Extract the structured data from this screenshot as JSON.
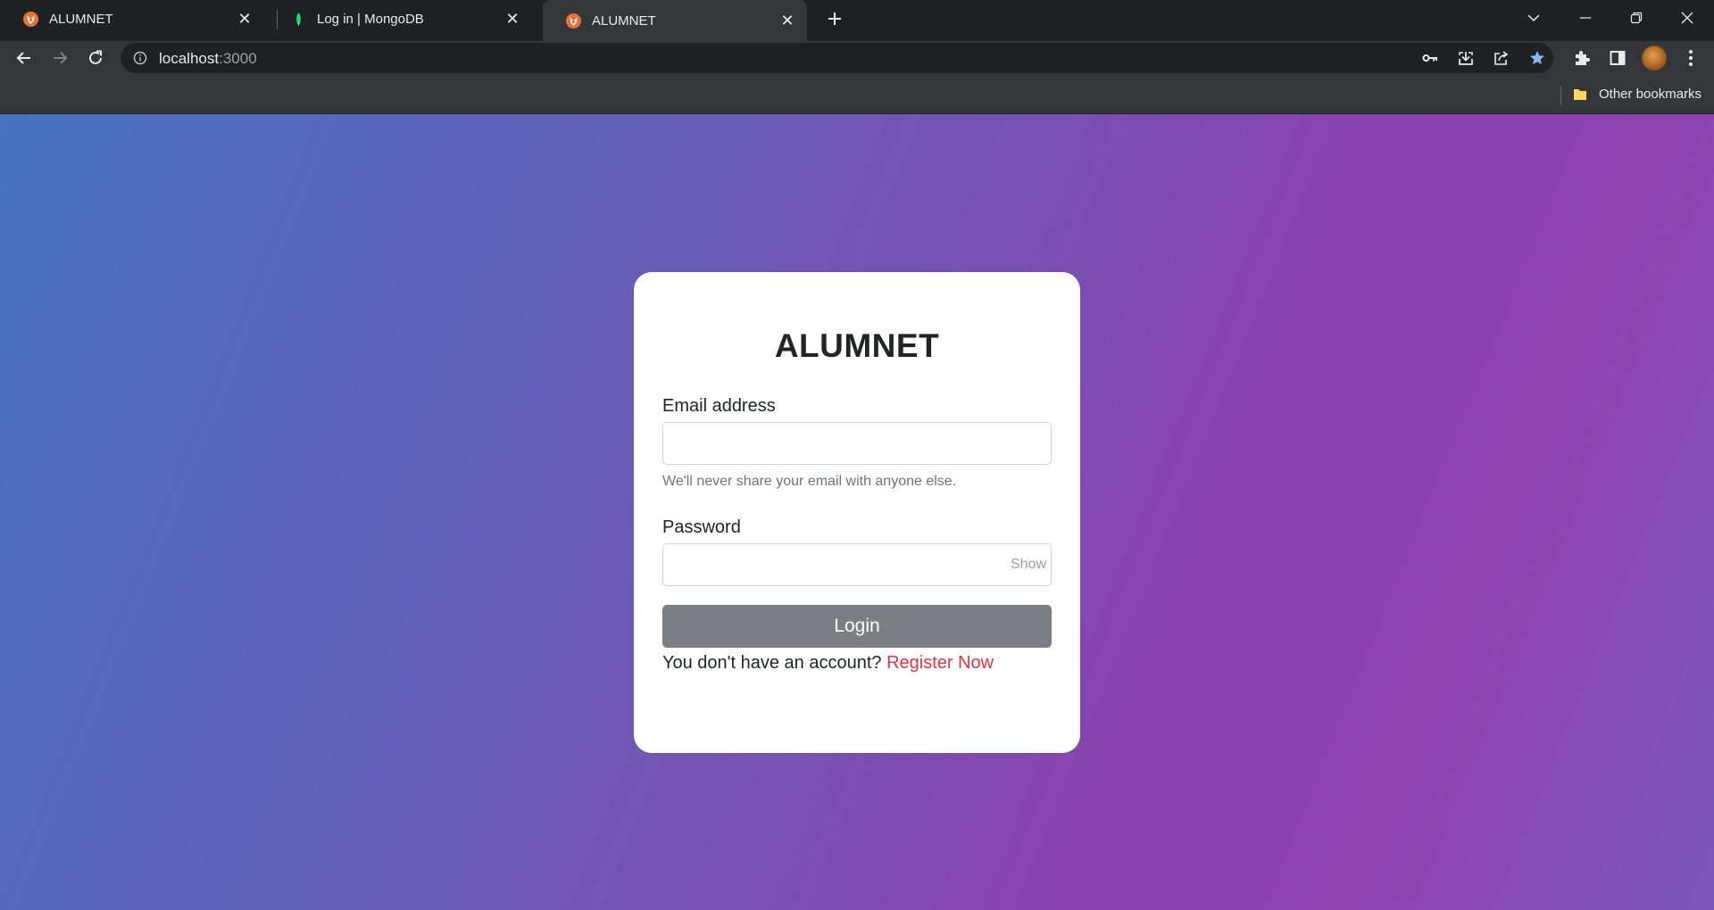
{
  "browser": {
    "tabs": [
      {
        "title": "ALUMNET",
        "favicon": "fox-logo-icon",
        "active": false
      },
      {
        "title": "Log in | MongoDB",
        "favicon": "mongodb-leaf-icon",
        "active": false
      },
      {
        "title": "ALUMNET",
        "favicon": "fox-logo-icon",
        "active": true
      }
    ],
    "address": {
      "host": "localhost",
      "port": ":3000"
    },
    "bookmarks": {
      "other_label": "Other bookmarks"
    },
    "colors": {
      "tabstrip": "#202124",
      "toolbar": "#35363a",
      "star": "#8ab4f8"
    }
  },
  "login": {
    "title": "ALUMNET",
    "email_label": "Email address",
    "email_value": "",
    "email_help": "We'll never share your email with anyone else.",
    "password_label": "Password",
    "password_value": "",
    "show_label": "Show",
    "submit_label": "Login",
    "register_prompt": "You don't have an account?",
    "register_link": "Register Now"
  },
  "theme": {
    "gradient_start": "#4873bd",
    "gradient_end": "#8e43ad",
    "card": "#ffffff",
    "button": "#7b7e82",
    "link": "#dc3545"
  }
}
